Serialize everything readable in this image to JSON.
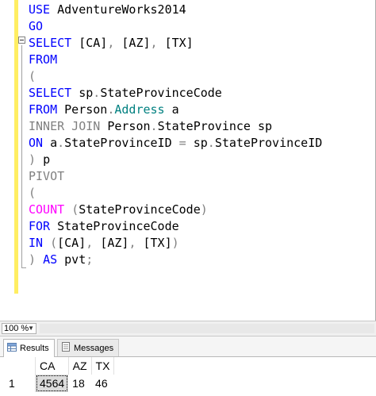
{
  "editor": {
    "lines": [
      [
        {
          "t": "USE ",
          "c": "kw"
        },
        {
          "t": "AdventureWorks2014",
          "c": ""
        }
      ],
      [
        {
          "t": "GO",
          "c": "kw"
        }
      ],
      [
        {
          "t": "SELECT ",
          "c": "kw"
        },
        {
          "t": "[CA]",
          "c": ""
        },
        {
          "t": ", ",
          "c": "gray"
        },
        {
          "t": "[AZ]",
          "c": ""
        },
        {
          "t": ", ",
          "c": "gray"
        },
        {
          "t": "[TX]",
          "c": ""
        }
      ],
      [
        {
          "t": "FROM",
          "c": "kw"
        }
      ],
      [
        {
          "t": "(",
          "c": "gray"
        }
      ],
      [
        {
          "t": "SELECT ",
          "c": "kw"
        },
        {
          "t": "sp",
          "c": ""
        },
        {
          "t": ".",
          "c": "gray"
        },
        {
          "t": "StateProvinceCode",
          "c": ""
        }
      ],
      [
        {
          "t": "FROM ",
          "c": "kw"
        },
        {
          "t": "Person",
          "c": ""
        },
        {
          "t": ".",
          "c": "gray"
        },
        {
          "t": "Address",
          "c": "teal"
        },
        {
          "t": " a",
          "c": ""
        }
      ],
      [
        {
          "t": "INNER JOIN ",
          "c": "gray"
        },
        {
          "t": "Person",
          "c": ""
        },
        {
          "t": ".",
          "c": "gray"
        },
        {
          "t": "StateProvince sp",
          "c": ""
        }
      ],
      [
        {
          "t": "ON ",
          "c": "kw"
        },
        {
          "t": "a",
          "c": ""
        },
        {
          "t": ".",
          "c": "gray"
        },
        {
          "t": "StateProvinceID ",
          "c": ""
        },
        {
          "t": "= ",
          "c": "gray"
        },
        {
          "t": "sp",
          "c": ""
        },
        {
          "t": ".",
          "c": "gray"
        },
        {
          "t": "StateProvinceID",
          "c": ""
        }
      ],
      [
        {
          "t": ") ",
          "c": "gray"
        },
        {
          "t": "p",
          "c": ""
        }
      ],
      [
        {
          "t": "PIVOT",
          "c": "gray"
        }
      ],
      [
        {
          "t": "(",
          "c": "gray"
        }
      ],
      [
        {
          "t": "COUNT ",
          "c": "pink"
        },
        {
          "t": "(",
          "c": "gray"
        },
        {
          "t": "StateProvinceCode",
          "c": ""
        },
        {
          "t": ")",
          "c": "gray"
        }
      ],
      [
        {
          "t": "FOR ",
          "c": "kw"
        },
        {
          "t": "StateProvinceCode",
          "c": ""
        }
      ],
      [
        {
          "t": "IN ",
          "c": "kw"
        },
        {
          "t": "(",
          "c": "gray"
        },
        {
          "t": "[CA]",
          "c": ""
        },
        {
          "t": ", ",
          "c": "gray"
        },
        {
          "t": "[AZ]",
          "c": ""
        },
        {
          "t": ", ",
          "c": "gray"
        },
        {
          "t": "[TX]",
          "c": ""
        },
        {
          "t": ")",
          "c": "gray"
        }
      ],
      [
        {
          "t": ") ",
          "c": "gray"
        },
        {
          "t": "AS ",
          "c": "kw"
        },
        {
          "t": "pvt",
          "c": ""
        },
        {
          "t": ";",
          "c": "gray"
        }
      ]
    ]
  },
  "zoom": {
    "value": "100 %"
  },
  "tabs": {
    "results_label": "Results",
    "messages_label": "Messages"
  },
  "grid": {
    "columns": [
      "CA",
      "AZ",
      "TX"
    ],
    "rows": [
      {
        "num": "1",
        "cells": [
          "4564",
          "18",
          "46"
        ]
      }
    ]
  },
  "colors": {
    "keyword": "#0000ff",
    "operator": "#808080",
    "function": "#ff00ff",
    "system_object": "#008080",
    "change_bar": "#ffee62"
  }
}
